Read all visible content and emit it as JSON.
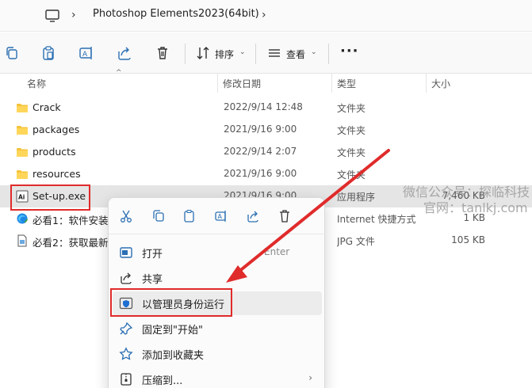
{
  "address_bar": {
    "icons": [
      "monitor-icon",
      "chevron-right-icon"
    ],
    "breadcrumb": "Photoshop Elements2023(64bit)"
  },
  "toolbar": {
    "icons": [
      "copy-icon",
      "paste-icon",
      "rename-icon",
      "share-icon",
      "delete-icon",
      "sort-icon",
      "view-icon"
    ],
    "sort_label": "排序",
    "view_label": "查看",
    "more_label": "···"
  },
  "columns": {
    "name": "名称",
    "date": "修改日期",
    "type": "类型",
    "size": "大小"
  },
  "files": [
    {
      "name": "Crack",
      "date": "2022/9/14 12:48",
      "type": "文件夹",
      "size": "",
      "icon": "folder-icon"
    },
    {
      "name": "packages",
      "date": "2021/9/16 9:00",
      "type": "文件夹",
      "size": "",
      "icon": "folder-icon"
    },
    {
      "name": "products",
      "date": "2022/9/14 2:07",
      "type": "文件夹",
      "size": "",
      "icon": "folder-icon"
    },
    {
      "name": "resources",
      "date": "2021/9/16 9:00",
      "type": "文件夹",
      "size": "",
      "icon": "folder-icon"
    },
    {
      "name": "Set-up.exe",
      "date": "2021/9/16 9:00",
      "type": "应用程序",
      "size": "7,460 KB",
      "icon": "adobe-app-icon"
    },
    {
      "name": "必看1：软件安装",
      "date": "",
      "type": "Internet 快捷方式",
      "size": "1 KB",
      "icon": "edge-shortcut-icon"
    },
    {
      "name": "必看2：获取最新",
      "date": "",
      "type": "JPG 文件",
      "size": "105 KB",
      "icon": "image-file-icon"
    }
  ],
  "context_menu": {
    "quick_actions": [
      "cut-icon",
      "copy-icon",
      "paste-icon",
      "rename-icon",
      "share-icon",
      "delete-icon"
    ],
    "items": [
      {
        "label": "打开",
        "hint": "Enter",
        "icon": "open-icon"
      },
      {
        "label": "共享",
        "hint": "",
        "icon": "share-icon"
      },
      {
        "label": "以管理员身份运行",
        "hint": "",
        "icon": "shield-icon"
      },
      {
        "label": "固定到\"开始\"",
        "hint": "",
        "icon": "pin-icon"
      },
      {
        "label": "添加到收藏夹",
        "hint": "",
        "icon": "star-icon"
      },
      {
        "label": "压缩到...",
        "hint": "",
        "icon": "zip-icon",
        "submenu": "›"
      }
    ]
  },
  "watermark": {
    "line1": "微信公众号：探临科技",
    "line2": "官网：tanlkj.com"
  },
  "annotation_color": "#e02b2b"
}
